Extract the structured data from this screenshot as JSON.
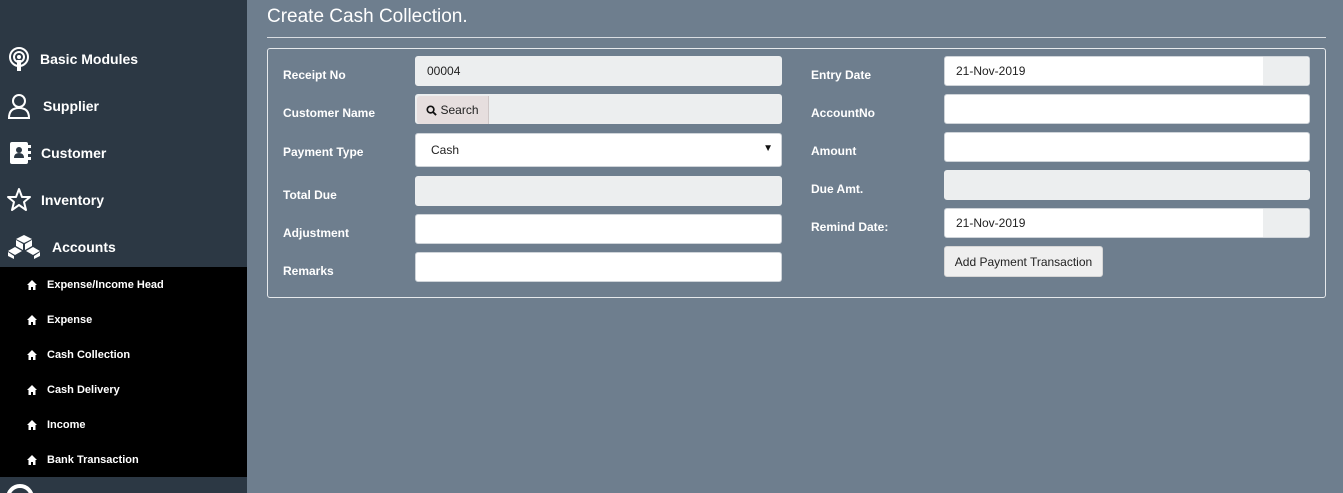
{
  "sidebar": {
    "items": [
      {
        "label": "Basic Modules",
        "icon": "podcast-icon"
      },
      {
        "label": "Supplier",
        "icon": "user-icon"
      },
      {
        "label": "Customer",
        "icon": "address-book-icon"
      },
      {
        "label": "Inventory",
        "icon": "star-icon"
      },
      {
        "label": "Accounts",
        "icon": "cubes-icon"
      }
    ],
    "submenu": [
      {
        "label": "Expense/Income Head",
        "icon": "home-icon"
      },
      {
        "label": "Expense",
        "icon": "home-icon"
      },
      {
        "label": "Cash Collection",
        "icon": "home-icon"
      },
      {
        "label": "Cash Delivery",
        "icon": "home-icon"
      },
      {
        "label": "Income",
        "icon": "home-icon"
      },
      {
        "label": "Bank Transaction",
        "icon": "home-icon"
      }
    ]
  },
  "page": {
    "title": "Create Cash Collection."
  },
  "form": {
    "receipt_no_label": "Receipt No",
    "receipt_no_value": "00004",
    "customer_name_label": "Customer Name",
    "search_label": "Search",
    "payment_type_label": "Payment Type",
    "payment_type_value": "Cash",
    "total_due_label": "Total Due",
    "total_due_value": "",
    "adjustment_label": "Adjustment",
    "adjustment_value": "",
    "remarks_label": "Remarks",
    "remarks_value": "",
    "entry_date_label": "Entry Date",
    "entry_date_value": "21-Nov-2019",
    "account_no_label": "AccountNo",
    "account_no_value": "",
    "amount_label": "Amount",
    "amount_value": "",
    "due_amt_label": "Due Amt.",
    "due_amt_value": "",
    "remind_date_label": "Remind Date:",
    "remind_date_value": "21-Nov-2019",
    "add_button_label": "Add Payment Transaction"
  },
  "colors": {
    "background": "#6e7e8e",
    "sidebar": "#2c3844",
    "submenu": "#000000"
  }
}
